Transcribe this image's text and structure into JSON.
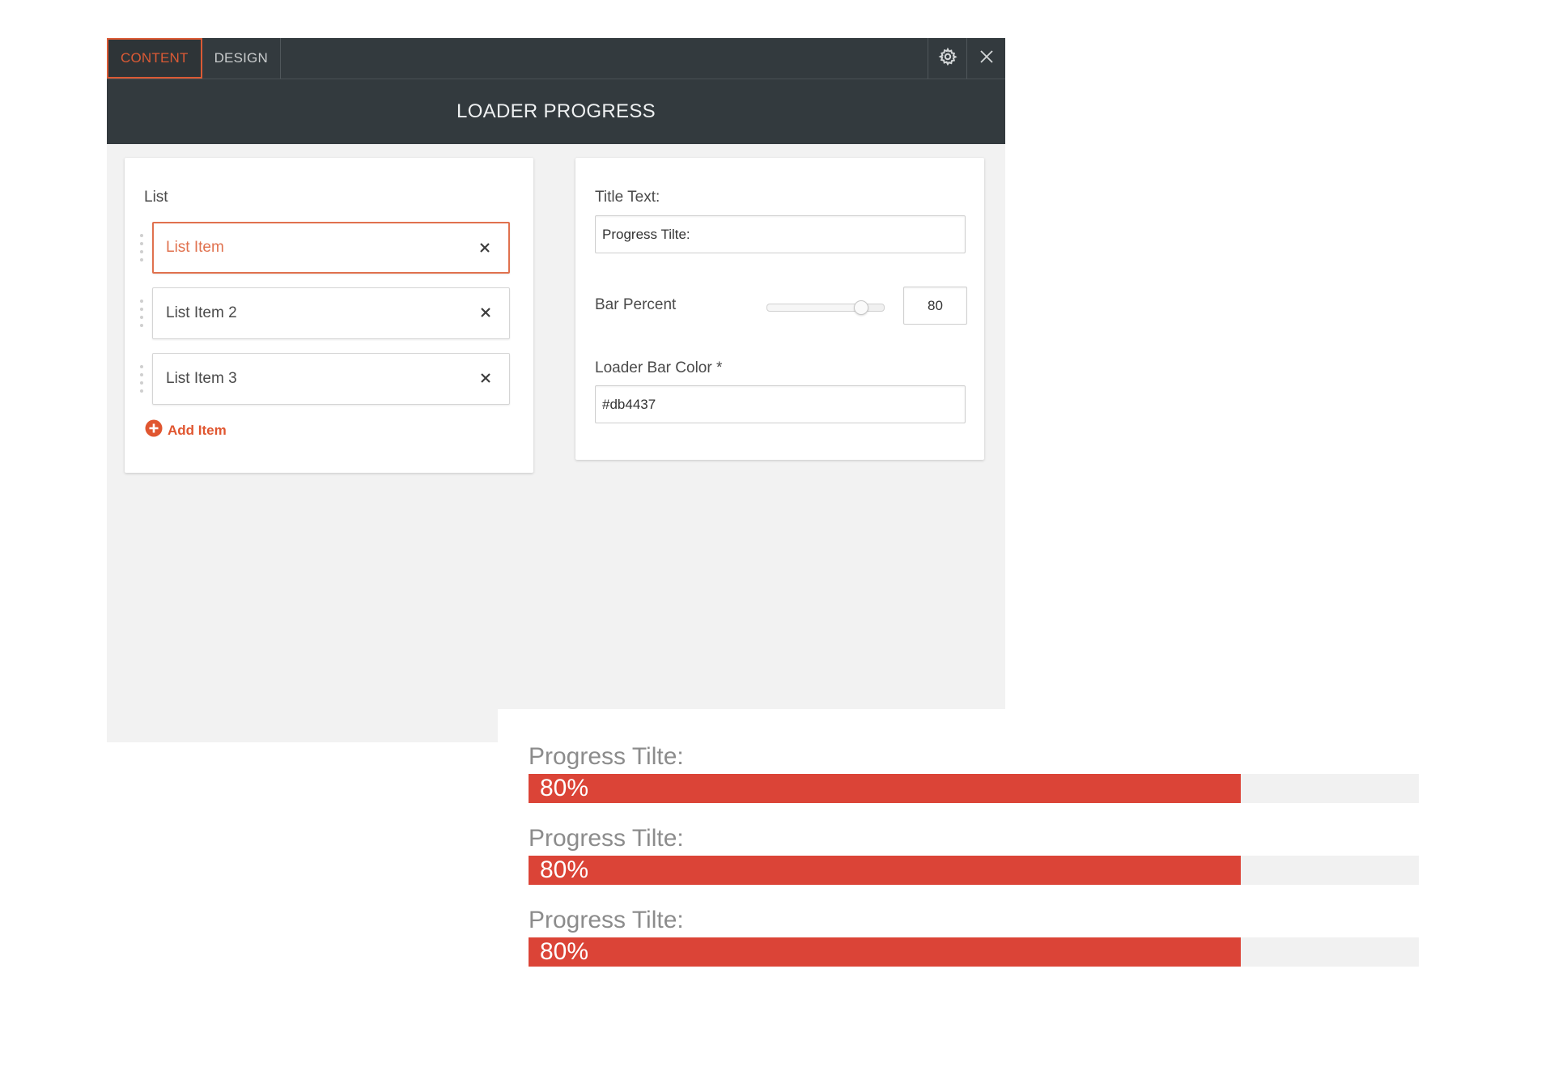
{
  "tabs": [
    {
      "label": "CONTENT",
      "active": true
    },
    {
      "label": "DESIGN",
      "active": false
    }
  ],
  "toolbar": {
    "settings_icon": "gear-icon",
    "close_icon": "close-icon"
  },
  "panel_title": "LOADER PROGRESS",
  "list": {
    "label": "List",
    "items": [
      {
        "label": "List Item",
        "active": true
      },
      {
        "label": "List Item 2",
        "active": false
      },
      {
        "label": "List Item 3",
        "active": false
      }
    ],
    "add_label": "Add Item"
  },
  "settings": {
    "title_label": "Title Text:",
    "title_value": "Progress Tilte:",
    "bar_percent_label": "Bar Percent",
    "bar_percent_value": "80",
    "color_label": "Loader Bar Color *",
    "color_value": "#db4437"
  },
  "preview": {
    "bars": [
      {
        "title": "Progress Tilte:",
        "percent_text": "80%",
        "percent": 80
      },
      {
        "title": "Progress Tilte:",
        "percent_text": "80%",
        "percent": 80
      },
      {
        "title": "Progress Tilte:",
        "percent_text": "80%",
        "percent": 80
      }
    ]
  },
  "colors": {
    "accent": "#db5a35",
    "bar_color": "#db4437",
    "topbar": "#333a3e"
  }
}
